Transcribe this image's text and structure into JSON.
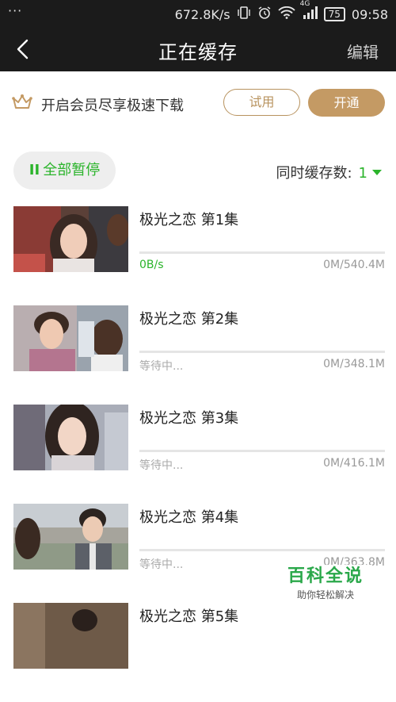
{
  "status_bar": {
    "dots": "···",
    "speed": "672.8K/s",
    "network": "4G",
    "battery": "75",
    "time": "09:58"
  },
  "header": {
    "title": "正在缓存",
    "edit_label": "编辑"
  },
  "vip_banner": {
    "text": "开启会员尽享极速下载",
    "trial_label": "试用",
    "open_label": "开通",
    "accent_color": "#c49a64"
  },
  "controls": {
    "pause_icon": "II",
    "pause_all_label": "全部暂停",
    "concurrent_label": "同时缓存数:",
    "concurrent_value": "1",
    "accent_color": "#2bb42b"
  },
  "downloads": [
    {
      "title": "极光之恋 第1集",
      "status": "0B/s",
      "size": "0M/540.4M",
      "progress": 0
    },
    {
      "title": "极光之恋 第2集",
      "status": "等待中...",
      "size": "0M/348.1M",
      "progress": 0
    },
    {
      "title": "极光之恋 第3集",
      "status": "等待中...",
      "size": "0M/416.1M",
      "progress": 0
    },
    {
      "title": "极光之恋 第4集",
      "status": "等待中...",
      "size": "0M/363.8M",
      "progress": 0
    },
    {
      "title": "极光之恋 第5集",
      "status": "",
      "size": "",
      "progress": 0
    }
  ],
  "watermark": {
    "title": "百科全说",
    "subtitle": "助你轻松解决"
  }
}
